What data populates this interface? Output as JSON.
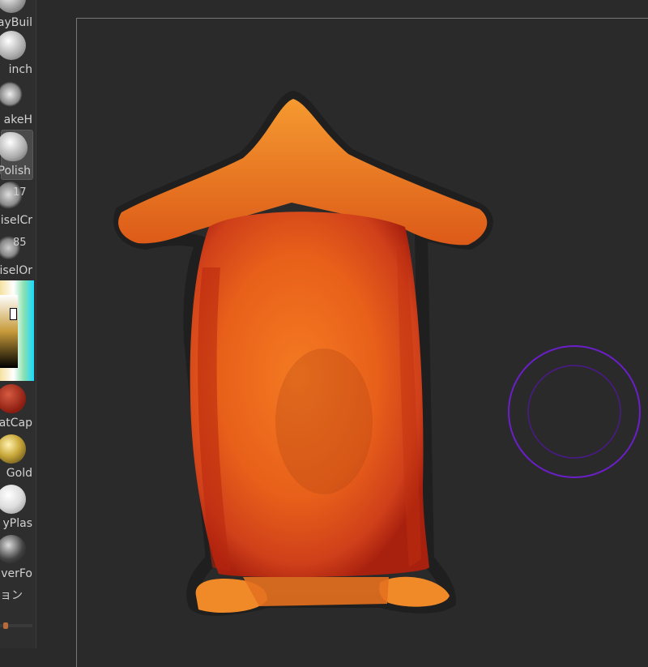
{
  "sidebar": {
    "brushes": [
      {
        "label": "ayBuil",
        "icon": "clay-buildup-brush-icon"
      },
      {
        "label": "inch",
        "icon": "pinch-brush-icon"
      },
      {
        "label": "akeH",
        "icon": "snakehook-brush-icon"
      },
      {
        "label": "Polish",
        "icon": "polish-brush-icon",
        "active": true
      },
      {
        "label": "iselCr",
        "icon": "chisel-creature-brush-icon",
        "count": "17"
      },
      {
        "label": "iselOr",
        "icon": "chisel-organic-brush-icon",
        "count": "85"
      }
    ],
    "materials": [
      {
        "label": "atCap",
        "icon": "flatcap-material-icon",
        "color": "#b2301c"
      },
      {
        "label": "Gold",
        "icon": "gold-material-icon",
        "color": "#c9a83a"
      },
      {
        "label": "yPlas",
        "icon": "clay-plastic-material-icon",
        "color": "#e6e6e6"
      },
      {
        "label": "verFo",
        "icon": "silver-material-icon",
        "color": "#555555"
      }
    ],
    "footer_label": "ョン"
  },
  "colors": {
    "accent_cursor": "#6a1fc9",
    "model_main": "#e8601a",
    "model_dark": "#b52310",
    "background": "#2a2a2a"
  }
}
